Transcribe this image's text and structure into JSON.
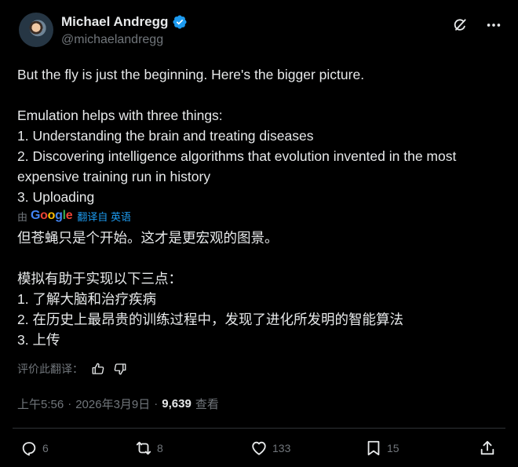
{
  "author": {
    "display_name": "Michael Andregg",
    "handle": "@michaelandregg"
  },
  "tweet": {
    "lines": [
      "But the fly is just the beginning. Here's the bigger picture.",
      "",
      "Emulation helps with three things:",
      "1. Understanding the brain and treating diseases",
      "2. Discovering intelligence algorithms that evolution invented in the most expensive training run in history",
      "3. Uploading"
    ]
  },
  "translation": {
    "prefix": "由",
    "provider_letters": [
      "G",
      "o",
      "o",
      "g",
      "l",
      "e"
    ],
    "link_label": "翻译自 英语",
    "lines": [
      "但苍蝇只是个开始。这才是更宏观的图景。",
      "",
      "模拟有助于实现以下三点：",
      "1. 了解大脑和治疗疾病",
      "2. 在历史上最昂贵的训练过程中，发现了进化所发明的智能算法",
      "3. 上传"
    ],
    "rate_label": "评价此翻译："
  },
  "meta": {
    "time": "上午5:56",
    "separator": "·",
    "date": "2026年3月9日",
    "views": "9,639",
    "views_label": "查看"
  },
  "actions": {
    "replies": "6",
    "retweets": "8",
    "likes": "133",
    "bookmarks": "15"
  },
  "icons": {
    "verified": "verified-badge-icon",
    "grok": "grok-icon",
    "more": "more-icon",
    "thumb_up": "thumbs-up-icon",
    "thumb_down": "thumbs-down-icon",
    "reply": "reply-icon",
    "retweet": "retweet-icon",
    "like": "heart-icon",
    "bookmark": "bookmark-icon",
    "share": "share-icon"
  },
  "colors": {
    "background": "#000000",
    "text": "#e7e9ea",
    "secondary": "#71767b",
    "accent": "#1d9bf0"
  }
}
